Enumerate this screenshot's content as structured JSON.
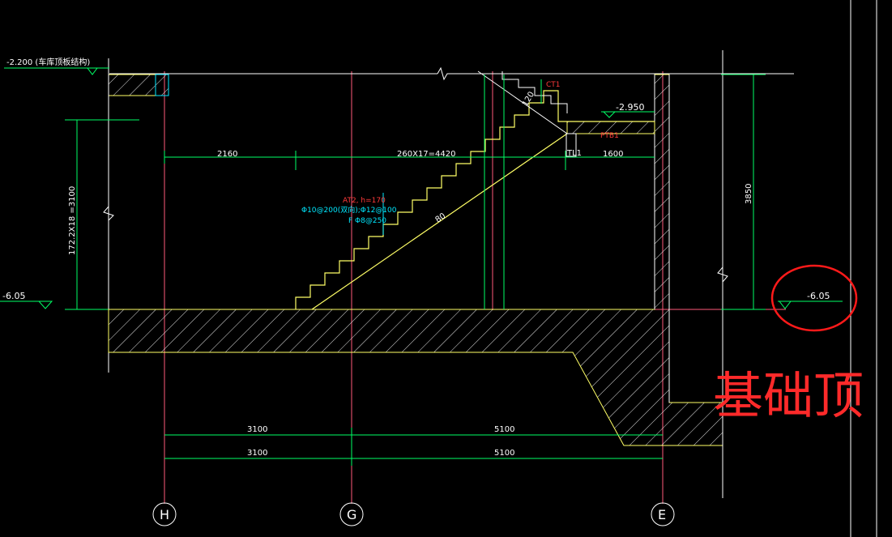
{
  "drawing": {
    "elev_top_left": "-2.200 (车库顶板结构)",
    "elev_left_bottom": "-6.05",
    "elev_right_bottom": "-6.05",
    "elev_landing": "-2.950",
    "dim_vertical_left": "172.2X18 =3100",
    "dim_vertical_right": "3850",
    "dim_top_1": "2160",
    "dim_top_2": "260X17=4420",
    "dim_top_3": "1600",
    "dim_bottom_1a": "3100",
    "dim_bottom_1b": "5100",
    "dim_bottom_2a": "3100",
    "dim_bottom_2b": "5100",
    "label_ct1": "CT1",
    "label_ptb1": "PTB1",
    "label_tl1": "TL1",
    "label_slope_top": "120",
    "label_slope_mid": "80",
    "stair_note_1": "AT2, h=170",
    "stair_note_2": "Φ10@200(双向);Φ12@100",
    "stair_note_3": "F Φ8@250",
    "axis_h": "H",
    "axis_g": "G",
    "axis_e": "E",
    "handwritten_note": "基础顶"
  },
  "colors": {
    "background": "#000000",
    "dimension": "#00ff66",
    "axis_line": "#ff5a7a",
    "concrete": "#ffff66",
    "text": "#ffffff",
    "annotation_red": "#ff3a3a",
    "annotation_cyan": "#00e8ff",
    "handwriting": "#ff1a1a"
  }
}
